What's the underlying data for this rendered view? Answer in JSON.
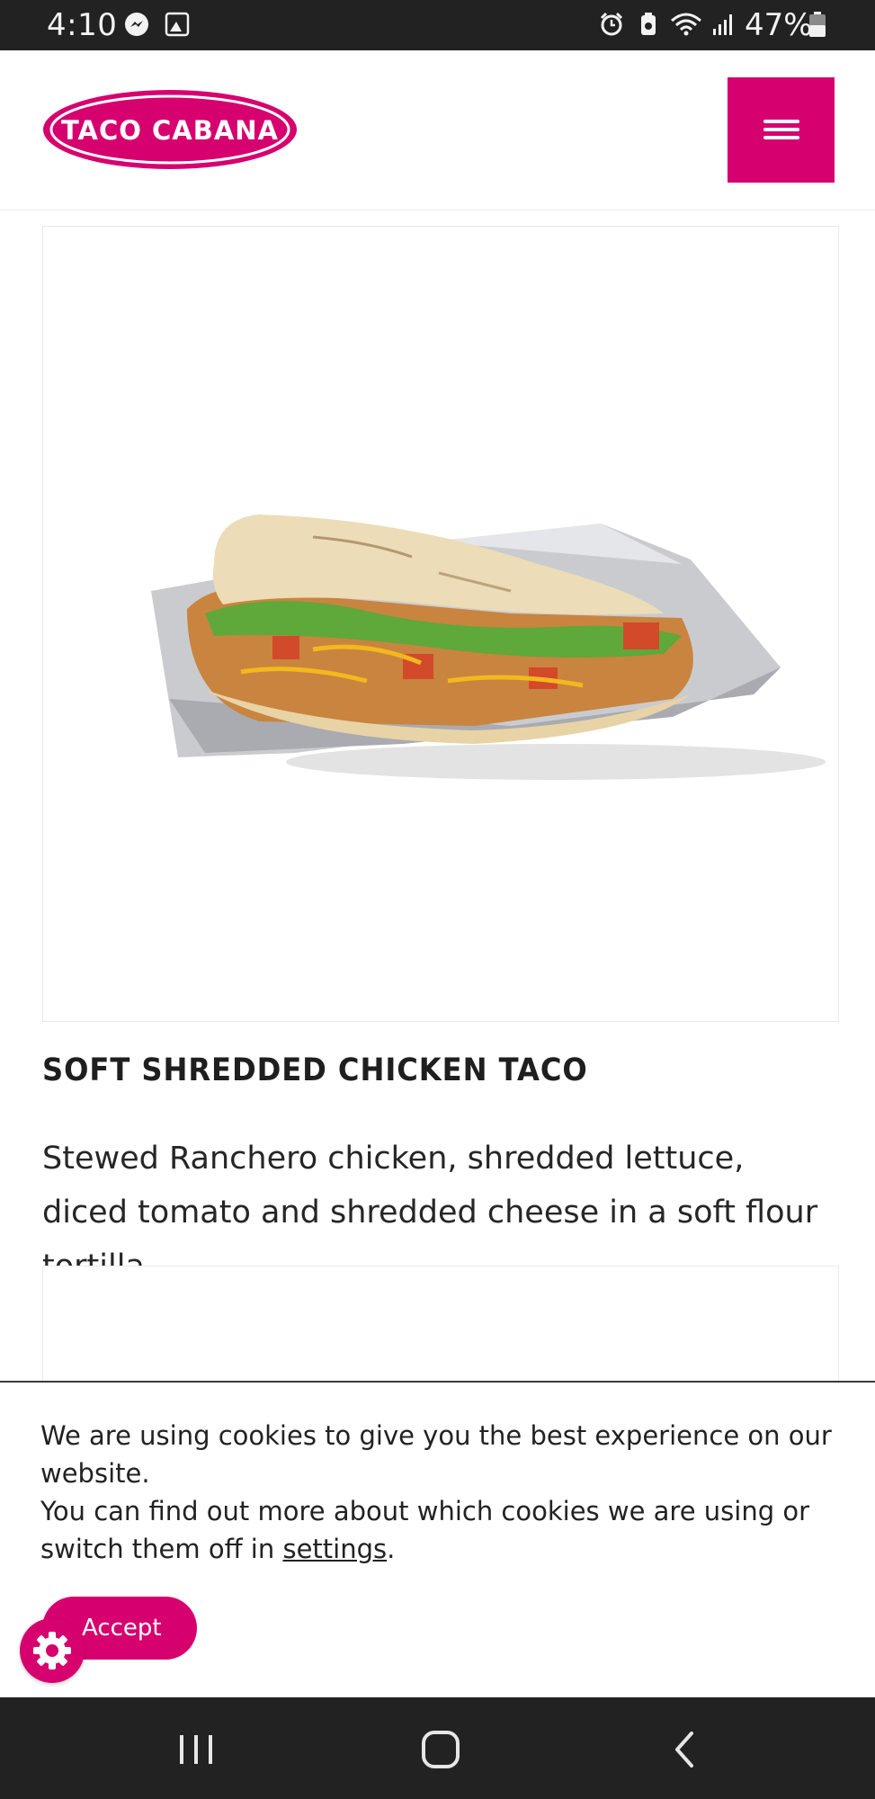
{
  "status_bar": {
    "time": "4:10",
    "battery": "47%",
    "icons": [
      "messenger-icon",
      "gallery-icon",
      "alarm-icon",
      "battery-saver-icon",
      "wifi-icon",
      "signal-icon",
      "battery-icon"
    ]
  },
  "header": {
    "logo_text": "TACO CABANA",
    "menu_icon": "hamburger-icon"
  },
  "product": {
    "image_alt": "soft shredded chicken taco on foil",
    "title": "SOFT SHREDDED CHICKEN TACO",
    "description": "Stewed Ranchero chicken, shredded lettuce, diced tomato and shredded cheese in a soft flour tortilla"
  },
  "cookie_banner": {
    "text_line1": "We are using cookies to give you the best experience on our website.",
    "text_line2_prefix": "You can find out more about which cookies we are using or switch them off in ",
    "settings_link": "settings",
    "text_line2_suffix": ".",
    "accept_label": "Accept",
    "settings_icon": "gear-icon"
  },
  "nav_bar": {
    "buttons": [
      "recent-apps-icon",
      "home-icon",
      "back-icon"
    ]
  },
  "colors": {
    "brand_pink": "#d6006f",
    "status_bar": "#222222"
  }
}
